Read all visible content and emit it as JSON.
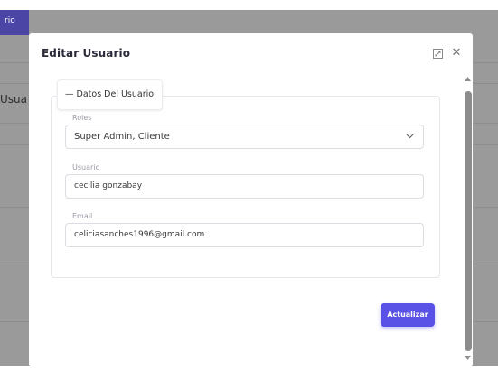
{
  "background": {
    "tab_label": "rio",
    "side_text": "Usua"
  },
  "modal": {
    "title": "Editar Usuario",
    "section_legend": "— Datos Del Usuario",
    "fields": {
      "roles": {
        "label": "Roles",
        "value": "Super Admin, Cliente"
      },
      "usuario": {
        "label": "Usuario",
        "value": "cecilia gonzabay"
      },
      "email": {
        "label": "Email",
        "value": "celiciasanches1996@gmail.com"
      }
    },
    "update_label": "Actualizar",
    "icons": [
      "maximize-icon",
      "close-icon",
      "chevron-down-icon"
    ]
  },
  "colors": {
    "primary": "#5a51e6",
    "background_tab": "#4b46a6",
    "overlay": "#9a9a9a"
  }
}
